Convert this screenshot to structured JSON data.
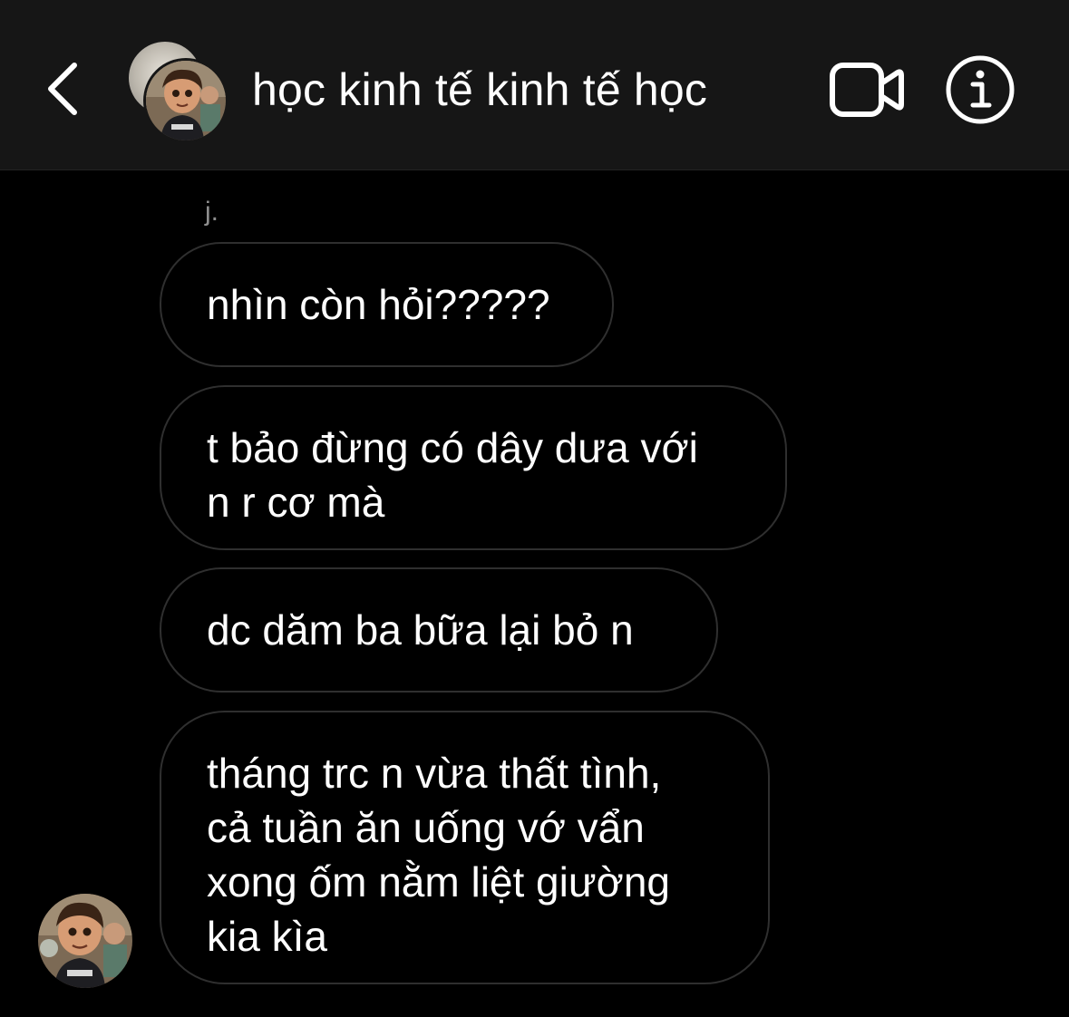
{
  "header": {
    "title": "học kinh tế kinh tế học",
    "back_icon": "chevron-left-icon",
    "video_icon": "video-camera-icon",
    "info_icon": "info-icon",
    "background": "#161616"
  },
  "thread": {
    "sender_name": "j.",
    "messages": [
      {
        "lines": [
          "nhìn còn hỏi?????"
        ]
      },
      {
        "lines": [
          "t bảo đừng có dây dưa với",
          "n r cơ mà"
        ]
      },
      {
        "lines": [
          "dc dăm ba bữa lại bỏ n"
        ]
      },
      {
        "lines": [
          "tháng trc n vừa thất tình,",
          "cả tuần ăn uống vớ vẩn",
          "xong ốm nằm liệt giường",
          "kia kìa"
        ]
      }
    ],
    "bubble_border_color": "#2f2f2f",
    "background": "#000000"
  }
}
